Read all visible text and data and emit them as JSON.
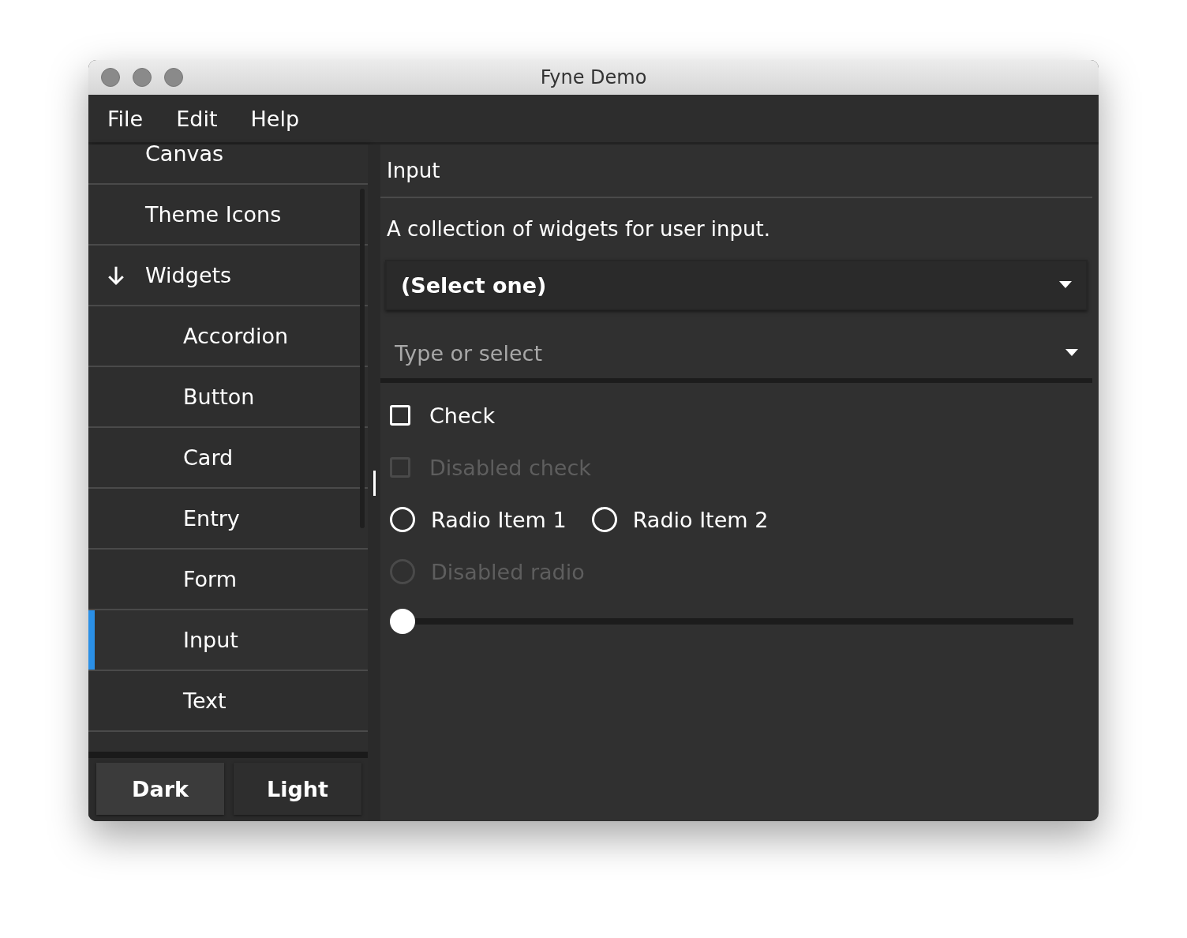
{
  "window": {
    "title": "Fyne Demo"
  },
  "menu": [
    "File",
    "Edit",
    "Help"
  ],
  "tree": [
    {
      "label": "Canvas",
      "selected": false
    },
    {
      "label": "Theme Icons",
      "selected": false
    },
    {
      "label": "Widgets",
      "selected": false,
      "expanded": true,
      "children": [
        {
          "label": "Accordion",
          "selected": false
        },
        {
          "label": "Button",
          "selected": false
        },
        {
          "label": "Card",
          "selected": false
        },
        {
          "label": "Entry",
          "selected": false
        },
        {
          "label": "Form",
          "selected": false
        },
        {
          "label": "Input",
          "selected": true
        },
        {
          "label": "Text",
          "selected": false
        }
      ]
    }
  ],
  "theme_buttons": [
    {
      "label": "Dark",
      "selected": true
    },
    {
      "label": "Light",
      "selected": false
    }
  ],
  "content": {
    "title": "Input",
    "description": "A collection of widgets for user input.",
    "select": {
      "value": "(Select one)"
    },
    "combo": {
      "placeholder": "Type or select"
    },
    "widgets": [
      {
        "kind": "check",
        "label": "Check",
        "checked": false,
        "disabled": false
      },
      {
        "kind": "check",
        "label": "Disabled check",
        "checked": false,
        "disabled": true
      },
      {
        "kind": "radio",
        "options": [
          {
            "label": "Radio Item 1",
            "selected": false
          },
          {
            "label": "Radio Item 2",
            "selected": false
          }
        ],
        "disabled": false
      },
      {
        "kind": "radio",
        "options": [
          {
            "label": "Disabled radio",
            "selected": false
          }
        ],
        "disabled": true
      },
      {
        "kind": "slider",
        "level": 0
      }
    ]
  }
}
